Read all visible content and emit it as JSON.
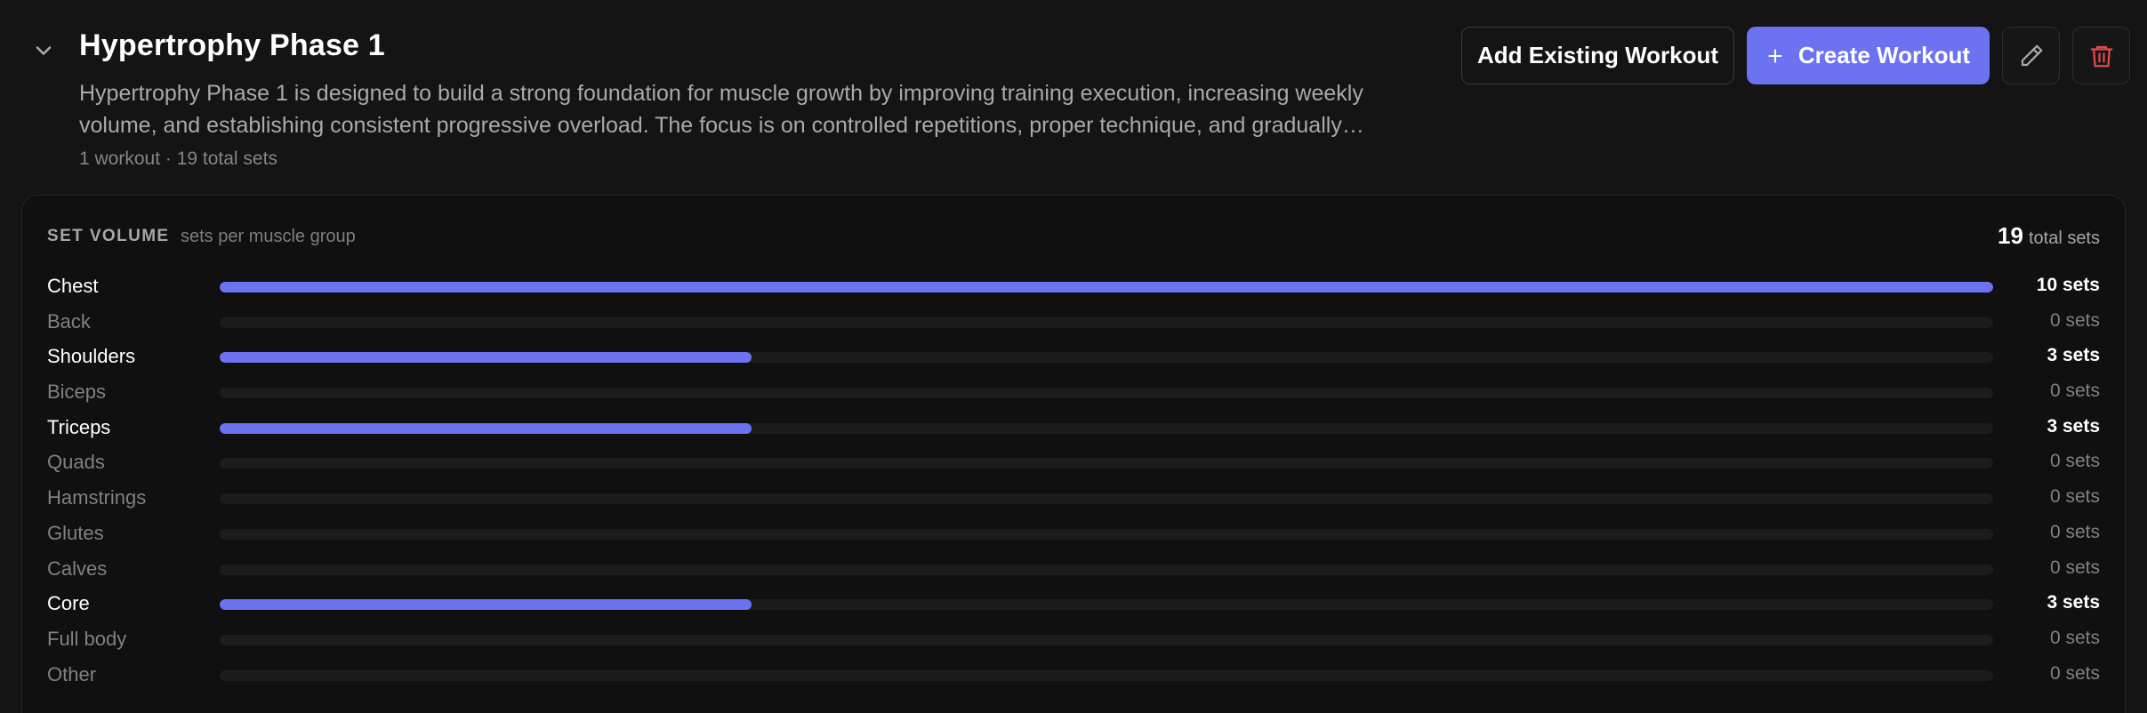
{
  "program": {
    "title": "Hypertrophy Phase 1",
    "description": "Hypertrophy Phase 1 is designed to build a strong foundation for muscle growth by improving training execution, increasing weekly volume, and establishing consistent progressive overload. The focus is on controlled repetitions, proper technique, and gradually…",
    "meta": "1 workout · 19 total sets"
  },
  "actions": {
    "add_existing_label": "Add Existing Workout",
    "create_label": "Create Workout",
    "edit_icon": "pencil-icon",
    "delete_icon": "trash-icon"
  },
  "colors": {
    "accent": "#6c72f0",
    "danger": "#e5484d",
    "background": "#141414",
    "card": "#101010"
  },
  "volume": {
    "title": "SET VOLUME",
    "subtitle": "sets per muscle group",
    "total_value": "19",
    "total_label": "total sets",
    "max_sets": 10,
    "rows": [
      {
        "label": "Chest",
        "sets": 10,
        "value_text": "10 sets"
      },
      {
        "label": "Back",
        "sets": 0,
        "value_text": "0 sets"
      },
      {
        "label": "Shoulders",
        "sets": 3,
        "value_text": "3 sets"
      },
      {
        "label": "Biceps",
        "sets": 0,
        "value_text": "0 sets"
      },
      {
        "label": "Triceps",
        "sets": 3,
        "value_text": "3 sets"
      },
      {
        "label": "Quads",
        "sets": 0,
        "value_text": "0 sets"
      },
      {
        "label": "Hamstrings",
        "sets": 0,
        "value_text": "0 sets"
      },
      {
        "label": "Glutes",
        "sets": 0,
        "value_text": "0 sets"
      },
      {
        "label": "Calves",
        "sets": 0,
        "value_text": "0 sets"
      },
      {
        "label": "Core",
        "sets": 3,
        "value_text": "3 sets"
      },
      {
        "label": "Full body",
        "sets": 0,
        "value_text": "0 sets"
      },
      {
        "label": "Other",
        "sets": 0,
        "value_text": "0 sets"
      }
    ]
  }
}
